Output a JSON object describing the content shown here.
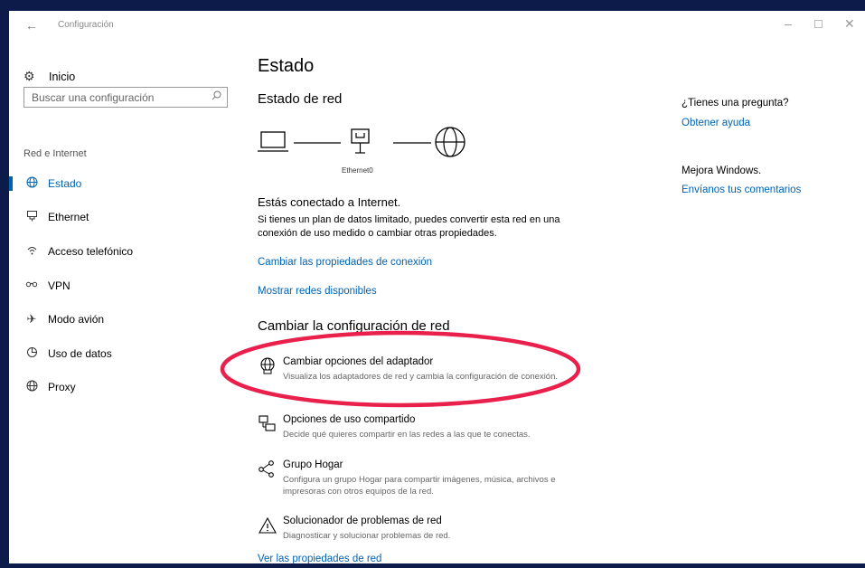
{
  "window": {
    "title": "Configuración",
    "back_icon": "back-arrow-icon",
    "controls": [
      "minimize-icon",
      "maximize-icon",
      "close-icon"
    ]
  },
  "sidebar": {
    "home_label": "Inicio",
    "search_placeholder": "Buscar una configuración",
    "category": "Red e Internet",
    "items": [
      {
        "label": "Estado",
        "icon": "globe-icon",
        "active": true
      },
      {
        "label": "Ethernet",
        "icon": "ethernet-icon"
      },
      {
        "label": "Acceso telefónico",
        "icon": "dialup-icon"
      },
      {
        "label": "VPN",
        "icon": "vpn-icon"
      },
      {
        "label": "Modo avión",
        "icon": "airplane-icon"
      },
      {
        "label": "Uso de datos",
        "icon": "data-usage-icon"
      },
      {
        "label": "Proxy",
        "icon": "globe-icon"
      }
    ]
  },
  "main": {
    "page_title": "Estado",
    "network_status_title": "Estado de red",
    "diagram_label": "Ethernet0",
    "connected_text": "Estás conectado a Internet.",
    "description": "Si tienes un plan de datos limitado, puedes convertir esta red en una conexión de uso medido o cambiar otras propiedades.",
    "link_change_properties": "Cambiar las propiedades de conexión",
    "link_show_networks": "Mostrar redes disponibles",
    "change_settings_title": "Cambiar la configuración de red",
    "options": [
      {
        "title": "Cambiar opciones del adaptador",
        "desc": "Visualiza los adaptadores de red y cambia la configuración de conexión.",
        "icon": "adapter-globe-icon"
      },
      {
        "title": "Opciones de uso compartido",
        "desc": "Decide qué quieres compartir en las redes a las que te conectas.",
        "icon": "sharing-icon"
      },
      {
        "title": "Grupo Hogar",
        "desc": "Configura un grupo Hogar para compartir imágenes, música, archivos e impresoras con otros equipos de la red.",
        "icon": "homegroup-icon"
      },
      {
        "title": "Solucionador de problemas de red",
        "desc": "Diagnosticar y solucionar problemas de red.",
        "icon": "warning-icon"
      }
    ],
    "link_view_properties": "Ver las propiedades de red"
  },
  "rightpane": {
    "question": "¿Tienes una pregunta?",
    "help_link": "Obtener ayuda",
    "improve": "Mejora Windows.",
    "feedback_link": "Envíanos tus comentarios"
  },
  "colors": {
    "accent": "#0063b1",
    "annotation": "#e8204b",
    "frame": "#0d1b4a"
  }
}
